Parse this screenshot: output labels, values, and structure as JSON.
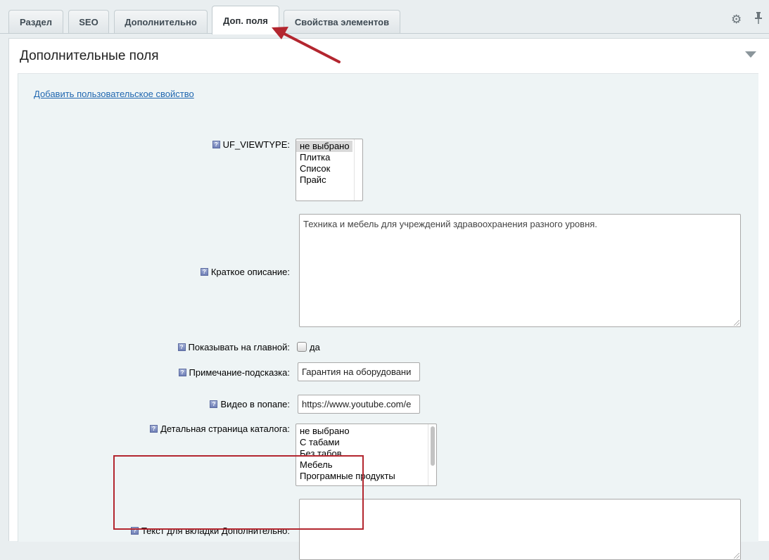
{
  "tabs": [
    {
      "label": "Раздел",
      "active": false
    },
    {
      "label": "SEO",
      "active": false
    },
    {
      "label": "Дополнительно",
      "active": false
    },
    {
      "label": "Доп. поля",
      "active": true
    },
    {
      "label": "Свойства элементов",
      "active": false
    }
  ],
  "toolbar": {
    "settings_icon": "gear-icon",
    "pin_icon": "pin-icon"
  },
  "panel": {
    "title": "Дополнительные поля",
    "add_link": "Добавить пользовательское свойство"
  },
  "help_icon": "?",
  "fields": {
    "viewtype": {
      "label": "UF_VIEWTYPE:",
      "options": [
        "не выбрано",
        "Плитка",
        "Список",
        "Прайс"
      ],
      "selected": "не выбрано"
    },
    "short_desc": {
      "label": "Краткое описание:",
      "value": "Техника и мебель для учреждений здравоохранения разного уровня."
    },
    "show_main": {
      "label": "Показывать на главной:",
      "checkbox_label": "да",
      "checked": false
    },
    "hint": {
      "label": "Примечание-подсказка:",
      "value": "Гарантия на оборудовани"
    },
    "video": {
      "label": "Видео в попапе:",
      "value": "https://www.youtube.com/e"
    },
    "catalog_page": {
      "label": "Детальная страница каталога:",
      "options": [
        "не выбрано",
        "С табами",
        "Без табов",
        "Мебель",
        "Програмные продукты"
      ]
    },
    "extra_tab_text": {
      "label": "Текст для вкладки Дополнительно:",
      "value": ""
    }
  },
  "colors": {
    "annotation_red": "#b3262f",
    "link_blue": "#2067b0"
  }
}
